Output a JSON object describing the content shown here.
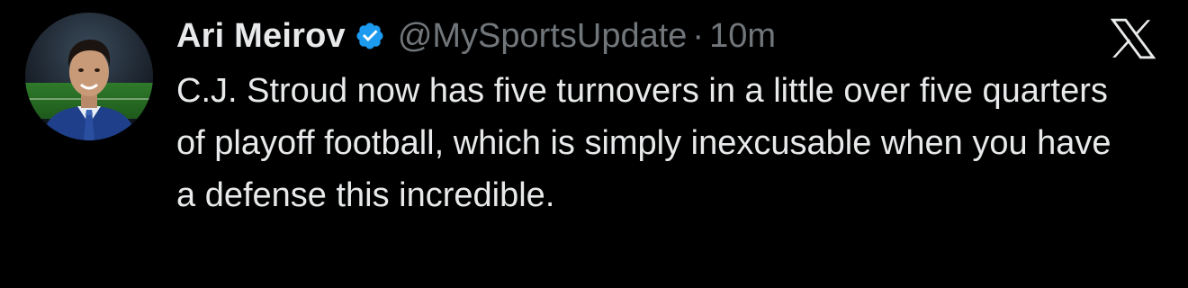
{
  "author": {
    "display_name": "Ari Meirov",
    "handle": "@MySportsUpdate",
    "separator": "·",
    "time": "10m",
    "verified": true,
    "verified_color": "#1d9bf0"
  },
  "tweet": {
    "text": "C.J. Stroud now has five turnovers in a little over five quarters of playoff football, which is simply inexcusable when you have a defense this incredible."
  },
  "icons": {
    "avatar": "avatar-photo",
    "verified": "verified-badge-icon",
    "platform": "x-logo-icon"
  },
  "colors": {
    "background": "#000000",
    "text_primary": "#e7e9ea",
    "text_secondary": "#71767b"
  }
}
